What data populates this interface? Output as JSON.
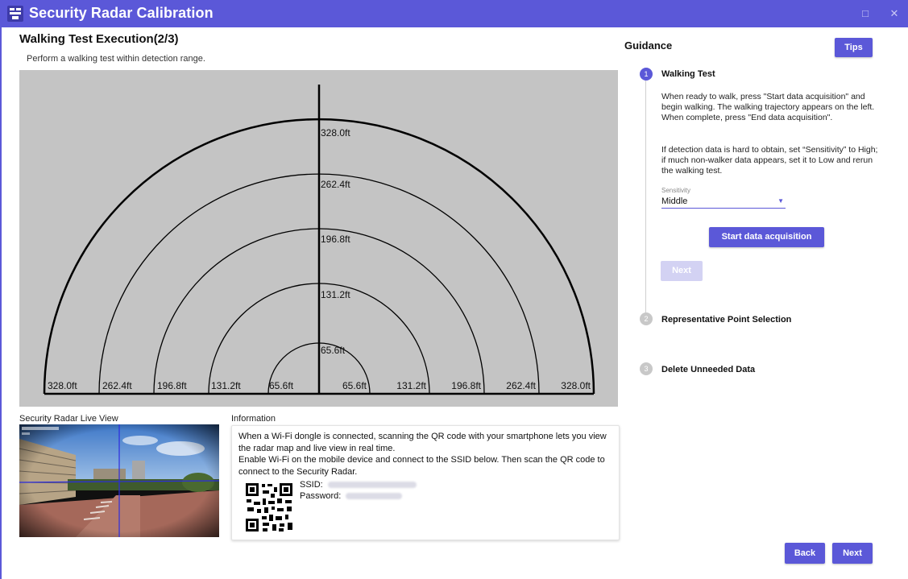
{
  "window": {
    "title": "Security Radar Calibration",
    "maximize_glyph": "□",
    "close_glyph": "✕"
  },
  "page": {
    "title": "Walking Test Execution(2/3)",
    "subtitle": "Perform a walking test within detection range."
  },
  "radar": {
    "arc_labels": [
      "328.0ft",
      "262.4ft",
      "196.8ft",
      "131.2ft",
      "65.6ft"
    ],
    "left_labels": [
      "328.0ft",
      "262.4ft",
      "196.8ft",
      "131.2ft",
      "65.6ft"
    ],
    "right_labels": [
      "65.6ft",
      "131.2ft",
      "196.8ft",
      "262.4ft",
      "328.0ft"
    ]
  },
  "live_view": {
    "label": "Security Radar Live View"
  },
  "information": {
    "title": "Information",
    "paragraph1": "When a Wi-Fi dongle is connected, scanning the QR code with your smartphone lets you view the radar map and live view in real time.",
    "paragraph2": "Enable Wi-Fi on the mobile device and connect to the SSID below. Then scan the QR code to connect to the Security Radar.",
    "ssid_label": "SSID:",
    "password_label": "Password:"
  },
  "guidance": {
    "title": "Guidance",
    "tips_label": "Tips",
    "steps": [
      {
        "number": "1",
        "title": "Walking Test"
      },
      {
        "number": "2",
        "title": "Representative Point Selection"
      },
      {
        "number": "3",
        "title": "Delete Unneeded Data"
      }
    ],
    "step1_text1": "When ready to walk, press \"Start data acquisition\" and begin walking. The walking trajectory appears on the left.",
    "step1_text2": "When complete, press \"End data acquisition\".",
    "step1_text3": "If detection data is hard to obtain, set “Sensitivity” to High; if much non-walker data appears, set it to Low and rerun the walking test.",
    "sensitivity_label": "Sensitivity",
    "sensitivity_value": "Middle",
    "start_button": "Start data acquisition",
    "step_next_button": "Next"
  },
  "footer": {
    "back_label": "Back",
    "next_label": "Next"
  },
  "colors": {
    "accent": "#5b58d8",
    "accent_disabled": "#d3d2f3",
    "radar_bg": "#c4c4c4",
    "step_inactive": "#c8c8c8"
  }
}
